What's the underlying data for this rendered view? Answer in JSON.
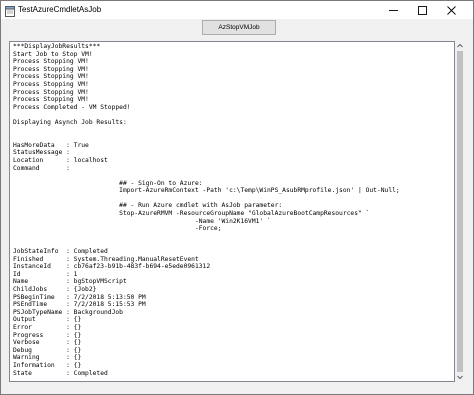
{
  "window": {
    "title": "TestAzureCmdletAsJob",
    "icon": "form-icon",
    "controls": [
      "minimize-icon",
      "maximize-icon",
      "close-icon"
    ]
  },
  "toolbar": {
    "action_button_label": "AzStopVMJob"
  },
  "output": {
    "lines": [
      "***DisplayJobResults***",
      "Start Job to Stop VM!",
      "Process Stopping VM!",
      "Process Stopping VM!",
      "Process Stopping VM!",
      "Process Stopping VM!",
      "Process Stopping VM!",
      "Process Stopping VM!",
      "Process Completed - VM Stopped!",
      "",
      "Displaying Asynch Job Results:",
      "",
      "",
      "HasMoreData   : True",
      "StatusMessage :",
      "Location      : localhost",
      "Command       :",
      "",
      "                            ## - Sign-On to Azure:",
      "                            Import-AzureRmContext -Path 'c:\\Temp\\WinPS_AsubRMprofile.json' | Out-Null;",
      "",
      "                            ## - Run Azure cmdlet with AsJob parameter:",
      "                            Stop-AzureRMVM -ResourceGroupName \"GlobalAzureBootCampResources\" `",
      "                                                -Name 'Win2K16VM1' `",
      "                                                -Force;",
      "",
      "",
      "JobStateInfo  : Completed",
      "Finished      : System.Threading.ManualResetEvent",
      "InstanceId    : cb76af23-b91b-483f-b694-e5ede0961312",
      "Id            : 1",
      "Name          : bgStopVMScript",
      "ChildJobs     : {Job2}",
      "PSBeginTime   : 7/2/2018 5:13:50 PM",
      "PSEndTime     : 7/2/2018 5:15:53 PM",
      "PSJobTypeName : BackgroundJob",
      "Output        : {}",
      "Error         : {}",
      "Progress      : {}",
      "Verbose       : {}",
      "Debug         : {}",
      "Warning       : {}",
      "Information   : {}",
      "State         : Completed"
    ]
  },
  "colors": {
    "window_bg": "#f0f0f0",
    "textbox_bg": "#ffffff",
    "button_bg": "#e1e1e1",
    "scroll_thumb": "#c1c1c1"
  }
}
